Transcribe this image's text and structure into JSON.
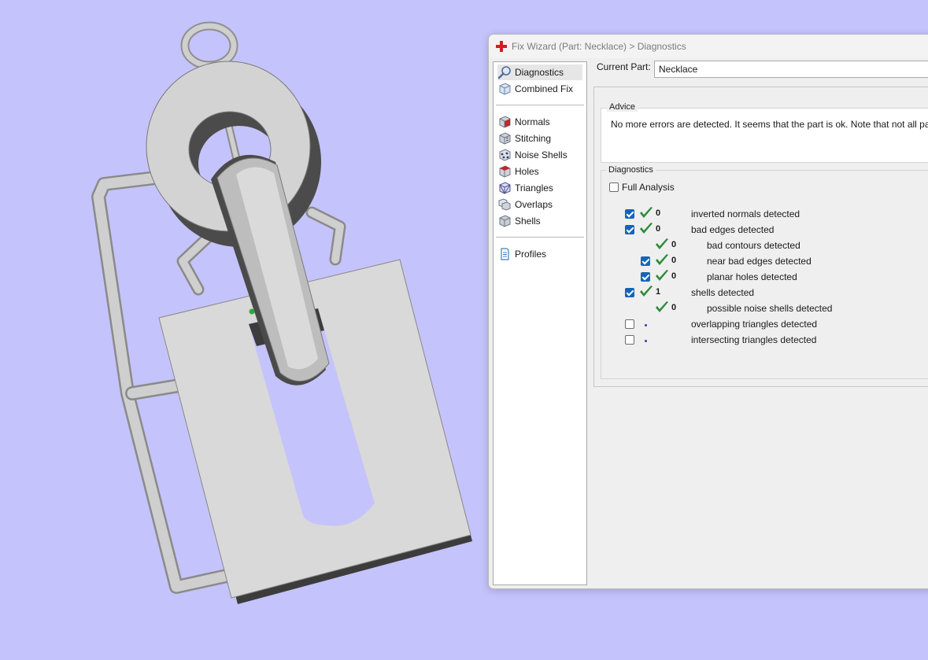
{
  "window": {
    "title": "Fix Wizard (Part: Necklace) > Diagnostics"
  },
  "nav": {
    "group1": [
      {
        "label": "Diagnostics",
        "icon": "magnifier-icon",
        "selected": true
      },
      {
        "label": "Combined Fix",
        "icon": "cube-icon"
      }
    ],
    "group2": [
      {
        "label": "Normals",
        "icon": "normals-cube-icon"
      },
      {
        "label": "Stitching",
        "icon": "stitching-cube-icon"
      },
      {
        "label": "Noise Shells",
        "icon": "noise-shells-icon"
      },
      {
        "label": "Holes",
        "icon": "holes-cube-icon"
      },
      {
        "label": "Triangles",
        "icon": "triangles-cube-icon"
      },
      {
        "label": "Overlaps",
        "icon": "overlaps-icon"
      },
      {
        "label": "Shells",
        "icon": "shells-cube-icon"
      }
    ],
    "group3": [
      {
        "label": "Profiles",
        "icon": "document-icon"
      }
    ]
  },
  "current_part": {
    "label": "Current Part:",
    "value": "Necklace"
  },
  "advice": {
    "title": "Advice",
    "text": "No more errors are detected. It seems that the part is ok. Note that not all paramete"
  },
  "diagnostics": {
    "title": "Diagnostics",
    "full_analysis": {
      "label": "Full Analysis",
      "checked": false
    },
    "rows": [
      {
        "checked": true,
        "status": "check",
        "count": "0",
        "label": "inverted normals detected",
        "indent": 0
      },
      {
        "checked": true,
        "status": "check",
        "count": "0",
        "label": "bad edges detected",
        "indent": 0
      },
      {
        "checked": null,
        "status": "check",
        "count": "0",
        "label": "bad contours detected",
        "indent": 1
      },
      {
        "checked": true,
        "status": "check",
        "count": "0",
        "label": "near bad edges detected",
        "indent": 1
      },
      {
        "checked": true,
        "status": "check",
        "count": "0",
        "label": "planar holes detected",
        "indent": 1
      },
      {
        "checked": true,
        "status": "check",
        "count": "1",
        "label": "shells detected",
        "indent": 0
      },
      {
        "checked": null,
        "status": "check",
        "count": "0",
        "label": "possible noise shells detected",
        "indent": 1
      },
      {
        "checked": false,
        "status": "dot",
        "count": "",
        "label": "overlapping triangles detected",
        "indent": 0
      },
      {
        "checked": false,
        "status": "dot",
        "count": "",
        "label": "intersecting triangles detected",
        "indent": 0
      }
    ]
  },
  "colors": {
    "background": "#c5c3fb",
    "check_green": "#2e8b3d",
    "checkbox_blue": "#1565b5",
    "model_gray": "#d4d4d4"
  }
}
